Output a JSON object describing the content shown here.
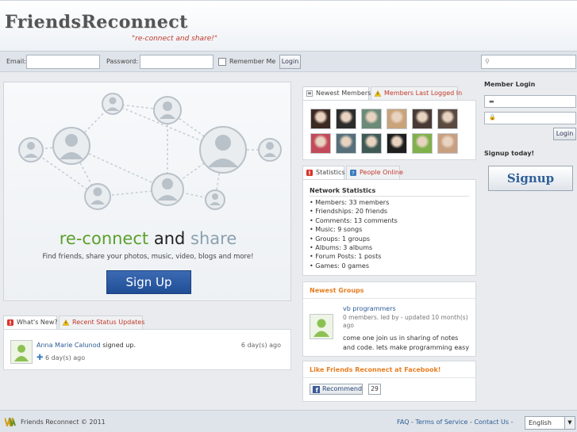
{
  "header": {
    "logo": "FriendsReconnect",
    "tagline": "\"re-connect and share!\""
  },
  "login_bar": {
    "email_label": "Email:",
    "password_label": "Password:",
    "remember_label": "Remember Me",
    "login_button": "Login",
    "search_placeholder": ""
  },
  "hero": {
    "word1": "re-connect",
    "word2": "and",
    "word3": "share",
    "subtitle": "Find friends, share your photos, music, video, blogs and more!",
    "signup_button": "Sign Up"
  },
  "activity": {
    "tab_whats_new": "What's New?",
    "tab_status": "Recent Status Updates",
    "item_user": "Anna Marie Calunod",
    "item_action": " signed up.",
    "item_time": "6 day(s) ago",
    "item_subtime": "6 day(s) ago"
  },
  "members": {
    "tab_newest": "Newest Members",
    "tab_last_logged": "Members Last Logged In",
    "thumb_colors": [
      "#3b2a22",
      "#2c2c2c",
      "#6b8a78",
      "#c9a37a",
      "#4a3a35",
      "#5a4a40",
      "#c24a5a",
      "#566f7a",
      "#3f5a55",
      "#1e1e1e",
      "#7fb04a",
      "#c8a080"
    ]
  },
  "stats": {
    "tab_statistics": "Statistics",
    "tab_online": "People Online",
    "title": "Network Statistics",
    "items": [
      "Members: 33 members",
      "Friendships: 20 friends",
      "Comments: 13 comments",
      "Music: 9 songs",
      "Groups: 1 groups",
      "Albums: 3 albums",
      "Forum Posts: 1 posts",
      "Games: 0 games"
    ]
  },
  "groups": {
    "title": "Newest Groups",
    "name": "vb programmers",
    "meta": "0 members. led by - updated 10 month(s) ago",
    "desc": "come one join us in sharing of notes and code. lets make programming easy"
  },
  "facebook": {
    "title": "Like Friends Reconnect at Facebook!",
    "recommend": "Recommend",
    "count": "29"
  },
  "sidebar": {
    "member_login": "Member Login",
    "login_button": "Login",
    "signup_today": "Signup today!",
    "signup_button": "Signup"
  },
  "footer": {
    "copyright": "Friends Reconnect © 2011",
    "faq": "FAQ",
    "terms": "Terms of Service",
    "contact": "Contact Us",
    "sep": "-",
    "language": "English"
  },
  "colors": {
    "accent_red": "#c0392b",
    "accent_orange": "#e67e22",
    "link_blue": "#2b5b94",
    "signup_blue": "#1f4d96"
  }
}
